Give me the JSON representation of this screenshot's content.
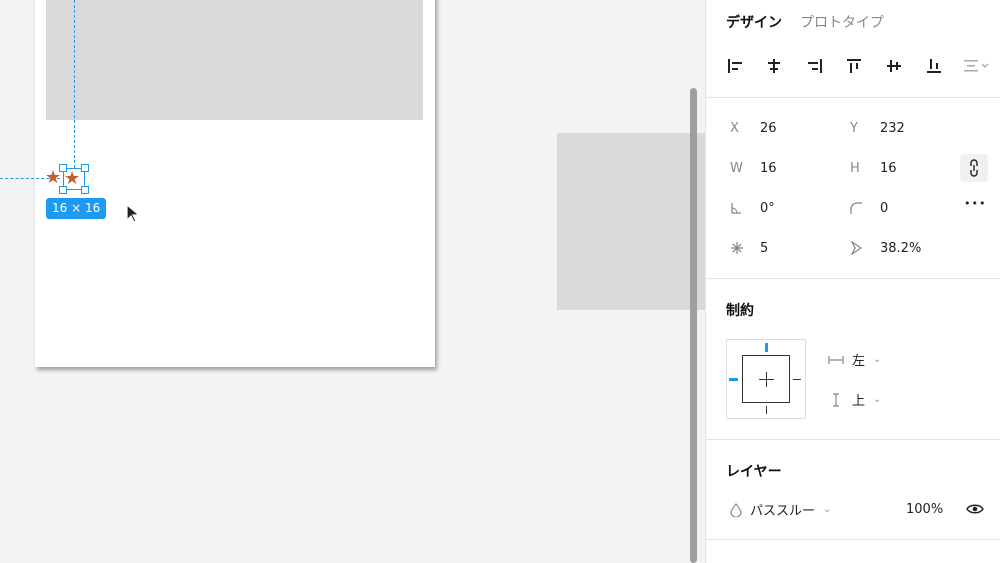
{
  "canvas": {
    "size_badge": "16 × 16",
    "star_glyph": "★"
  },
  "panel": {
    "tabs": [
      {
        "label": "デザイン",
        "active": true
      },
      {
        "label": "プロトタイプ",
        "active": false
      }
    ],
    "props": {
      "x_label": "X",
      "x_value": "26",
      "y_label": "Y",
      "y_value": "232",
      "w_label": "W",
      "w_value": "16",
      "h_label": "H",
      "h_value": "16",
      "rotation_value": "0°",
      "radius_value": "0",
      "count_value": "5",
      "ratio_value": "38.2%",
      "more_glyph": "•••"
    },
    "constraints": {
      "title": "制約",
      "horizontal": "左",
      "vertical": "上"
    },
    "layer": {
      "title": "レイヤー",
      "blend_mode": "パススルー",
      "opacity": "100%"
    }
  },
  "colors": {
    "accent": "#1e9bf0",
    "star": "#c15f34",
    "shape_fill": "#d9d9d9"
  }
}
